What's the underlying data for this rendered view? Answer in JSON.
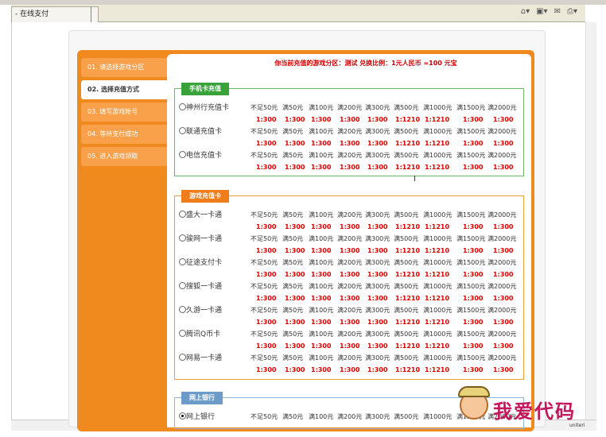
{
  "browser": {
    "tab_title": "在线支付"
  },
  "steps": [
    {
      "label": "01. 请选择游戏分区",
      "active": false
    },
    {
      "label": "02. 选择充值方式",
      "active": true
    },
    {
      "label": "03. 填写游戏帐号",
      "active": false
    },
    {
      "label": "04. 等待支付成功",
      "active": false
    },
    {
      "label": "05. 进入游戏领取",
      "active": false
    }
  ],
  "headline": "你当前充值的游戏分区：测试  兑换比例：1元人民币 =100 元宝",
  "denominations": [
    "不足50元",
    "满50元",
    "满100元",
    "满200元",
    "满300元",
    "满500元",
    "满1000元",
    "满1500元",
    "满2000元"
  ],
  "ratios": [
    "1:300",
    "1:300",
    "1:300",
    "1:300",
    "1:300",
    "1:1210",
    "1:1210",
    "1:300",
    "1:300"
  ],
  "groups": [
    {
      "title": "手机卡充值",
      "color": "#3aa23a",
      "cards": [
        "神州行充值卡",
        "联通充值卡",
        "电信充值卡"
      ]
    },
    {
      "title": "游戏充值卡",
      "color": "#f07d1a",
      "cards": [
        "盛大一卡通",
        "骏网一卡通",
        "征途支付卡",
        "搜狐一卡通",
        "久游一卡通",
        "腾讯Q币卡",
        "网易一卡通"
      ]
    },
    {
      "title": "网上银行",
      "color": "#6d9bc8",
      "cards": [
        "网上银行"
      ]
    }
  ],
  "watermark": {
    "text": "我爱代码",
    "sub": "uniteri"
  }
}
